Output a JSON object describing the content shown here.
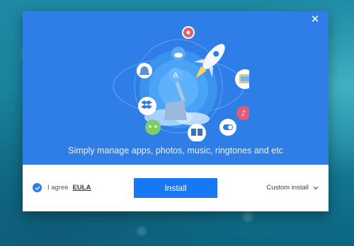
{
  "dialog": {
    "close_icon": "close-icon",
    "tagline": "Simply manage apps, photos, music, ringtones and etc"
  },
  "footer": {
    "agree_label": "I agree",
    "eula_label": "EULA",
    "agree_checked": true,
    "install_label": "Install",
    "custom_install_label": "Custom install"
  },
  "colors": {
    "hero_blue": "#2f7de6",
    "button_blue": "#1877f2",
    "footer_bg": "#ffffff"
  },
  "icons": [
    "cloud-icon",
    "bell-icon",
    "dropbox-icon",
    "android-icon",
    "rocket-icon",
    "app-store-icon",
    "broom-icon",
    "photo-icon",
    "music-icon",
    "book-icon",
    "toggle-icon",
    "flower-icon"
  ]
}
